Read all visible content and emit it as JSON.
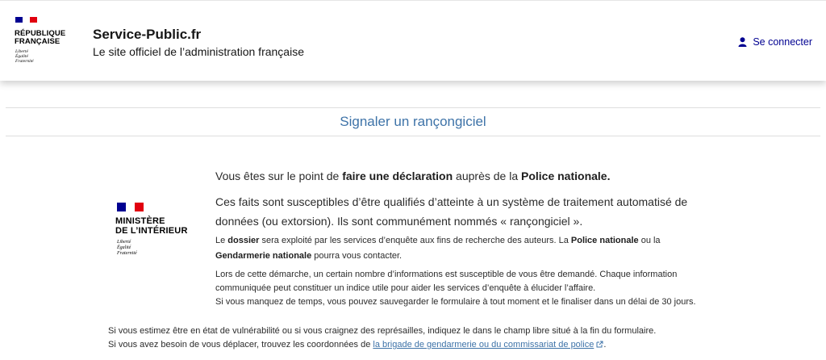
{
  "header": {
    "republic_line1": "RÉPUBLIQUE",
    "republic_line2": "FRANÇAISE",
    "motto": [
      "Liberté",
      "Égalité",
      "Fraternité"
    ],
    "site_title": "Service-Public.fr",
    "tagline": "Le site officiel de l’administration française",
    "login_label": "Se connecter"
  },
  "page": {
    "title": "Signaler un rançongiciel"
  },
  "ministry": {
    "line1": "MINISTÈRE",
    "line2": "DE L’INTÉRIEUR",
    "motto": [
      "Liberté",
      "Égalité",
      "Fraternité"
    ]
  },
  "content": {
    "lead1": {
      "part1": "Vous êtes sur le point de ",
      "bold1": "faire une déclaration",
      "part2": " auprès de la ",
      "bold2": "Police nationale.",
      "part3": ""
    },
    "lead2": "Ces faits sont susceptibles d’être qualifiés d’atteinte à un système de traitement automatisé de données (ou extorsion). Ils sont communément nommés « rançongiciel ».",
    "small1": {
      "part1": "Le ",
      "bold1": "dossier",
      "part2": " sera exploité par les services d’enquête aux fins de recherche des auteurs. La ",
      "bold2": "Police nationale",
      "part3": " ou la ",
      "bold3": "Gendarmerie nationale",
      "part4": " pourra vous contacter."
    },
    "small2": [
      "Lors de cette démarche, un certain nombre d’informations est susceptible de vous être demandé. Chaque information",
      "communiquée peut constituer un indice utile pour aider les services d’enquête à élucider l’affaire.",
      "Si vous manquez de temps, vous pouvez sauvegarder le formulaire à tout moment et le finaliser dans un délai de 30 jours."
    ],
    "bottom1": "Si vous estimez être en état de vulnérabilité ou si vous craignez des représailles, indiquez le dans le champ libre situé à la fin du formulaire.",
    "bottom2": {
      "before": "Si vous avez besoin de vous déplacer, trouvez les coordonnées de ",
      "link": "la brigade de gendarmerie ou du commissariat de police",
      "after": "."
    }
  },
  "colors": {
    "brand_blue": "#000091",
    "brand_red": "#e1000f",
    "title_blue": "#3e73a8"
  },
  "icons": {
    "login": "user-icon",
    "external": "external-link-icon"
  }
}
